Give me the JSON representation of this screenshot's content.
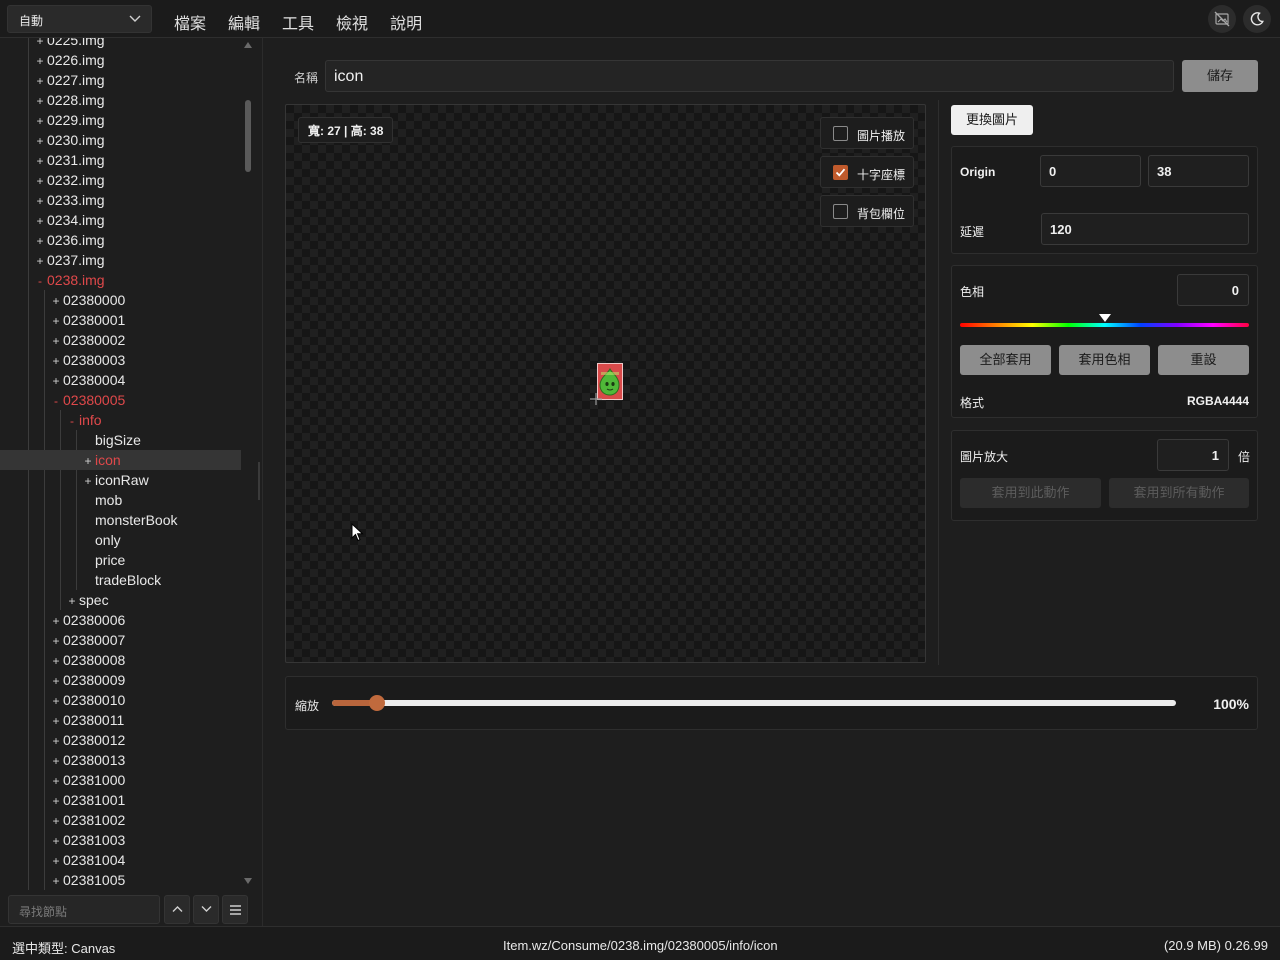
{
  "topbar": {
    "mode_value": "自動",
    "menu": [
      "檔案",
      "編輯",
      "工具",
      "檢視",
      "說明"
    ]
  },
  "tree": {
    "rows": [
      {
        "sign": "+",
        "label": "0225.img",
        "state": "normal"
      },
      {
        "sign": "+",
        "label": "0226.img",
        "state": "normal"
      },
      {
        "sign": "+",
        "label": "0227.img",
        "state": "normal"
      },
      {
        "sign": "+",
        "label": "0228.img",
        "state": "normal"
      },
      {
        "sign": "+",
        "label": "0229.img",
        "state": "normal"
      },
      {
        "sign": "+",
        "label": "0230.img",
        "state": "normal"
      },
      {
        "sign": "+",
        "label": "0231.img",
        "state": "normal"
      },
      {
        "sign": "+",
        "label": "0232.img",
        "state": "normal"
      },
      {
        "sign": "+",
        "label": "0233.img",
        "state": "normal"
      },
      {
        "sign": "+",
        "label": "0234.img",
        "state": "normal"
      },
      {
        "sign": "+",
        "label": "0236.img",
        "state": "normal"
      },
      {
        "sign": "+",
        "label": "0237.img",
        "state": "normal"
      },
      {
        "sign": "-",
        "label": "0238.img",
        "state": "open"
      },
      {
        "sign": "+",
        "label": "02380000",
        "state": "normal"
      },
      {
        "sign": "+",
        "label": "02380001",
        "state": "normal"
      },
      {
        "sign": "+",
        "label": "02380002",
        "state": "normal"
      },
      {
        "sign": "+",
        "label": "02380003",
        "state": "normal"
      },
      {
        "sign": "+",
        "label": "02380004",
        "state": "normal"
      },
      {
        "sign": "-",
        "label": "02380005",
        "state": "open"
      },
      {
        "sign": "-",
        "label": "info",
        "state": "open"
      },
      {
        "sign": "",
        "label": "bigSize",
        "state": "normal"
      },
      {
        "sign": "+",
        "label": "icon",
        "state": "selected"
      },
      {
        "sign": "+",
        "label": "iconRaw",
        "state": "normal"
      },
      {
        "sign": "",
        "label": "mob",
        "state": "normal"
      },
      {
        "sign": "",
        "label": "monsterBook",
        "state": "normal"
      },
      {
        "sign": "",
        "label": "only",
        "state": "normal"
      },
      {
        "sign": "",
        "label": "price",
        "state": "normal"
      },
      {
        "sign": "",
        "label": "tradeBlock",
        "state": "normal"
      },
      {
        "sign": "+",
        "label": "spec",
        "state": "normal"
      },
      {
        "sign": "+",
        "label": "02380006",
        "state": "normal"
      },
      {
        "sign": "+",
        "label": "02380007",
        "state": "normal"
      },
      {
        "sign": "+",
        "label": "02380008",
        "state": "normal"
      },
      {
        "sign": "+",
        "label": "02380009",
        "state": "normal"
      },
      {
        "sign": "+",
        "label": "02380010",
        "state": "normal"
      },
      {
        "sign": "+",
        "label": "02380011",
        "state": "normal"
      },
      {
        "sign": "+",
        "label": "02380012",
        "state": "normal"
      },
      {
        "sign": "+",
        "label": "02380013",
        "state": "normal"
      },
      {
        "sign": "+",
        "label": "02381000",
        "state": "normal"
      },
      {
        "sign": "+",
        "label": "02381001",
        "state": "normal"
      },
      {
        "sign": "+",
        "label": "02381002",
        "state": "normal"
      },
      {
        "sign": "+",
        "label": "02381003",
        "state": "normal"
      },
      {
        "sign": "+",
        "label": "02381004",
        "state": "normal"
      },
      {
        "sign": "+",
        "label": "02381005",
        "state": "normal"
      }
    ],
    "search_placeholder": "尋找節點"
  },
  "editor": {
    "name_label": "名稱",
    "name_value": "icon",
    "save_label": "儲存",
    "dimensions": "寬: 27 | 高: 38",
    "options": [
      {
        "label": "圖片播放",
        "checked": false
      },
      {
        "label": "十字座標",
        "checked": true
      },
      {
        "label": "背包欄位",
        "checked": false
      }
    ],
    "zoom_label": "縮放",
    "zoom_value": "100%",
    "zoom_fraction": 0.053
  },
  "props": {
    "change_image_label": "更換圖片",
    "origin_label": "Origin",
    "origin_x": "0",
    "origin_y": "38",
    "delay_label": "延遲",
    "delay_value": "120",
    "hue_label": "色相",
    "hue_value": "0",
    "hue_fraction": 0.5,
    "apply_all_label": "全部套用",
    "apply_hue_label": "套用色相",
    "reset_label": "重設",
    "format_label": "格式",
    "format_value": "RGBA4444",
    "scale_label": "圖片放大",
    "scale_value": "1",
    "scale_unit": "倍",
    "apply_this_label": "套用到此動作",
    "apply_every_label": "套用到所有動作"
  },
  "status": {
    "selected_type": "選中類型: Canvas",
    "path": "Item.wz/Consume/0238.img/02380005/info/icon",
    "memory_version": "(20.9 MB)  0.26.99"
  },
  "colors": {
    "accent": "#c05a2c",
    "tree_open": "#e0494b",
    "button_gray": "#8d8d8d"
  }
}
